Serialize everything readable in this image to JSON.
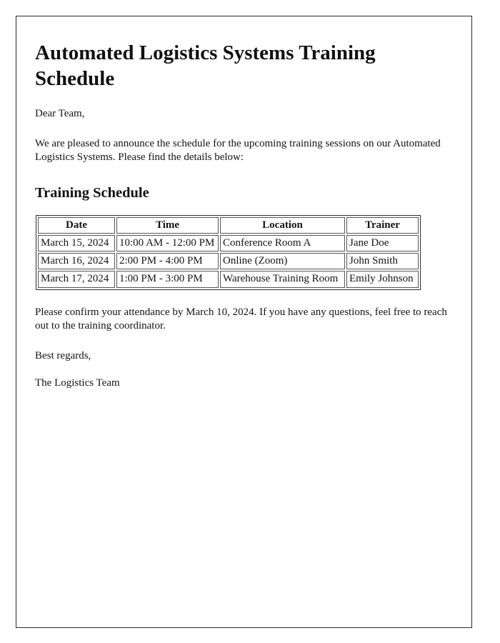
{
  "document": {
    "title": "Automated Logistics Systems Training Schedule",
    "salutation": "Dear Team,",
    "intro": "We are pleased to announce the schedule for the upcoming training sessions on our Automated Logistics Systems. Please find the details below:",
    "section_heading": "Training Schedule",
    "closing_note": "Please confirm your attendance by March 10, 2024. If you have any questions, feel free to reach out to the training coordinator.",
    "signoff": "Best regards,",
    "signature": "The Logistics Team"
  },
  "table": {
    "headers": {
      "date": "Date",
      "time": "Time",
      "location": "Location",
      "trainer": "Trainer"
    },
    "rows": [
      {
        "date": "March 15, 2024",
        "time": "10:00 AM - 12:00 PM",
        "location": "Conference Room A",
        "trainer": "Jane Doe"
      },
      {
        "date": "March 16, 2024",
        "time": "2:00 PM - 4:00 PM",
        "location": "Online (Zoom)",
        "trainer": "John Smith"
      },
      {
        "date": "March 17, 2024",
        "time": "1:00 PM - 3:00 PM",
        "location": "Warehouse Training Room",
        "trainer": "Emily Johnson"
      }
    ]
  },
  "colors": {
    "page_border": "#2b2b2b",
    "text": "#141414",
    "table_border": "#555555",
    "background": "#ffffff"
  }
}
